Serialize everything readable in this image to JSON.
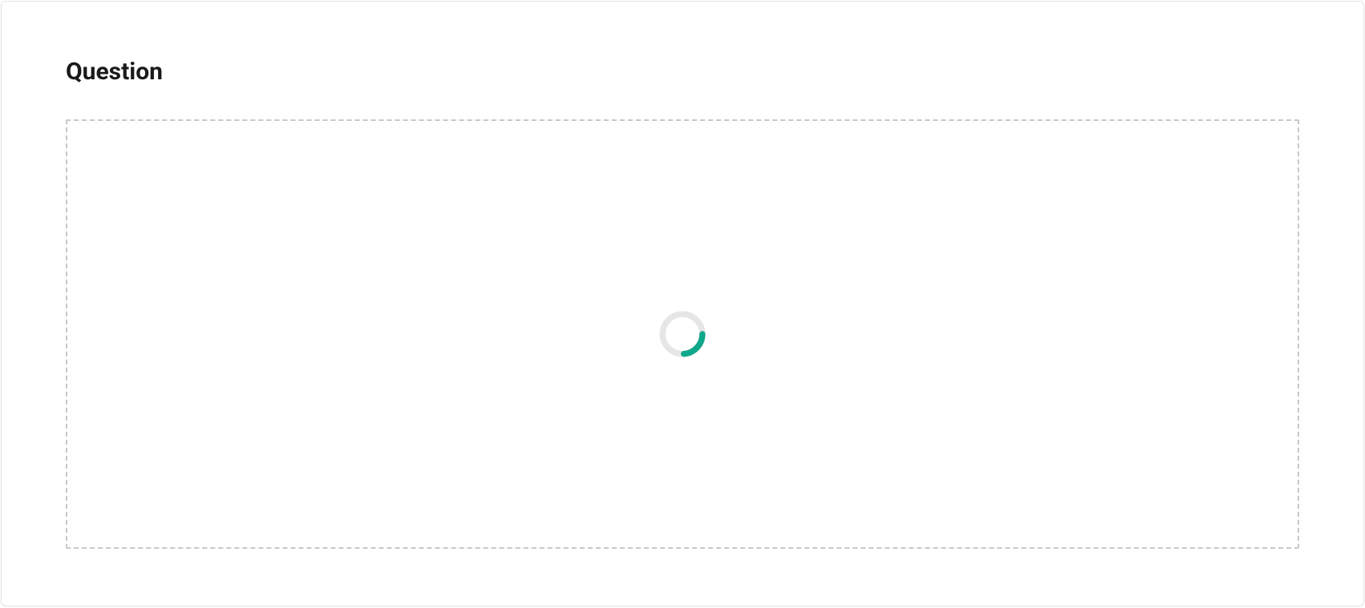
{
  "heading": "Question",
  "spinner": {
    "track_color": "#e6e6e6",
    "accent_color": "#10a88a"
  }
}
